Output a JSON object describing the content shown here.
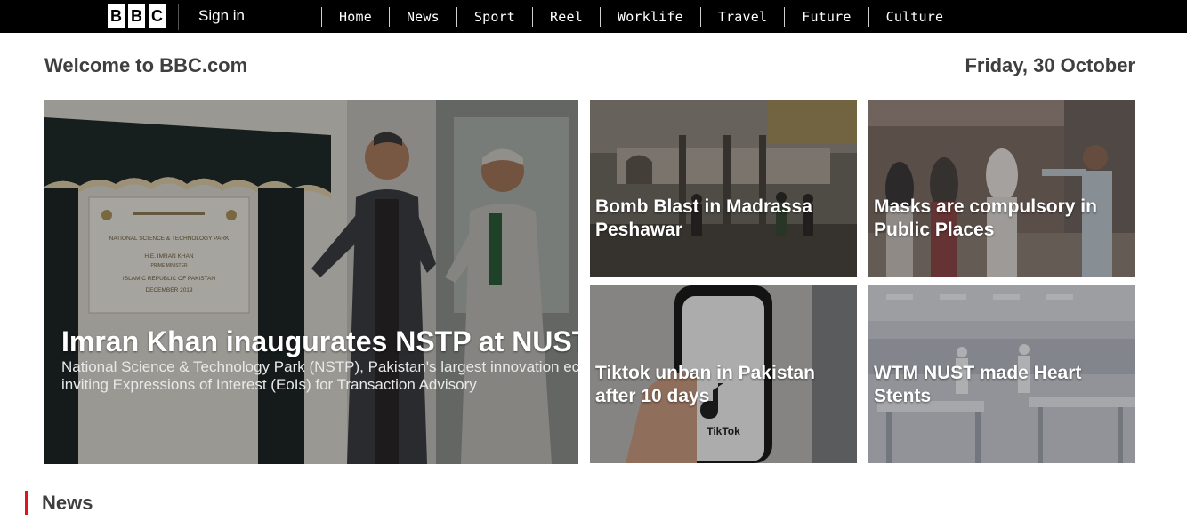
{
  "header": {
    "logo_letters": [
      "B",
      "B",
      "C"
    ],
    "sign_in": "Sign in",
    "nav": [
      "Home",
      "News",
      "Sport",
      "Reel",
      "Worklife",
      "Travel",
      "Future",
      "Culture"
    ]
  },
  "welcome": "Welcome to BBC.com",
  "date": "Friday, 30 October",
  "hero": {
    "title": "Imran Khan inaugurates NSTP at NUST",
    "summary": "National Science & Technology Park (NSTP), Pakistan's largest innovation ecosystem, is inviting Expressions of Interest (EoIs) for Transaction Advisory",
    "plaque_lines": [
      "NATIONAL SCIENCE & TECHNOLOGY PARK",
      "H.E. IMRAN KHAN",
      "PRIME MINISTER",
      "ISLAMIC REPUBLIC OF PAKISTAN",
      "DECEMBER 2019"
    ]
  },
  "tiles": [
    {
      "title": "Bomb Blast in Madrassa Peshawar"
    },
    {
      "title": "Masks are compulsory in Public Places"
    },
    {
      "title": "Tiktok unban in Pakistan after 10 days",
      "image_text": "TikTok"
    },
    {
      "title": "WTM NUST made Heart Stents"
    }
  ],
  "section": {
    "title": "News"
  },
  "colors": {
    "accent": "#e0131f",
    "topbar": "#000000"
  }
}
